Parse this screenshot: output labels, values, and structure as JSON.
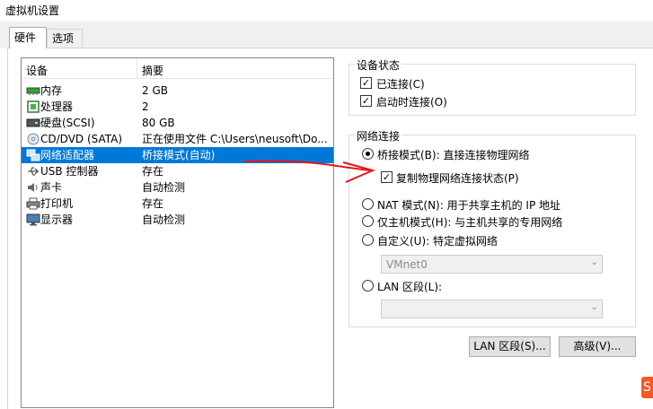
{
  "window": {
    "title": "虚拟机设置"
  },
  "tabs": [
    {
      "label": "硬件"
    },
    {
      "label": "选项"
    }
  ],
  "device_list": {
    "columns": [
      "设备",
      "摘要"
    ],
    "rows": [
      {
        "name": "内存",
        "summary": "2 GB",
        "icon": "memory-icon"
      },
      {
        "name": "处理器",
        "summary": "2",
        "icon": "cpu-icon"
      },
      {
        "name": "硬盘(SCSI)",
        "summary": "80 GB",
        "icon": "harddisk-icon"
      },
      {
        "name": "CD/DVD (SATA)",
        "summary": "正在使用文件 C:\\Users\\neusoft\\Do...",
        "icon": "cdrom-icon"
      },
      {
        "name": "网络适配器",
        "summary": "桥接模式(自动)",
        "icon": "network-adapter-icon",
        "selected": true
      },
      {
        "name": "USB 控制器",
        "summary": "存在",
        "icon": "usb-icon"
      },
      {
        "name": "声卡",
        "summary": "自动检测",
        "icon": "sound-icon"
      },
      {
        "name": "打印机",
        "summary": "存在",
        "icon": "printer-icon"
      },
      {
        "name": "显示器",
        "summary": "自动检测",
        "icon": "display-icon"
      }
    ]
  },
  "device_status": {
    "legend": "设备状态",
    "connected": {
      "label": "已连接(C)",
      "checked": true
    },
    "connect_at_power_on": {
      "label": "启动时连接(O)",
      "checked": true
    }
  },
  "network": {
    "legend": "网络连接",
    "bridged": {
      "label": "桥接模式(B): 直接连接物理网络",
      "selected": true
    },
    "replicate": {
      "label": "复制物理网络连接状态(P)",
      "checked": true
    },
    "nat": {
      "label": "NAT 模式(N): 用于共享主机的 IP 地址",
      "selected": false
    },
    "host_only": {
      "label": "仅主机模式(H): 与主机共享的专用网络",
      "selected": false
    },
    "custom": {
      "label": "自定义(U): 特定虚拟网络",
      "selected": false,
      "dropdown_value": "VMnet0"
    },
    "lan_segment": {
      "label": "LAN 区段(L):",
      "selected": false,
      "dropdown_value": ""
    }
  },
  "buttons": {
    "lan_segments": "LAN 区段(S)...",
    "advanced": "高级(V)..."
  },
  "colors": {
    "selection": "#0078d7",
    "annotation_red": "#e8141c",
    "logo": "#f45a1f"
  }
}
